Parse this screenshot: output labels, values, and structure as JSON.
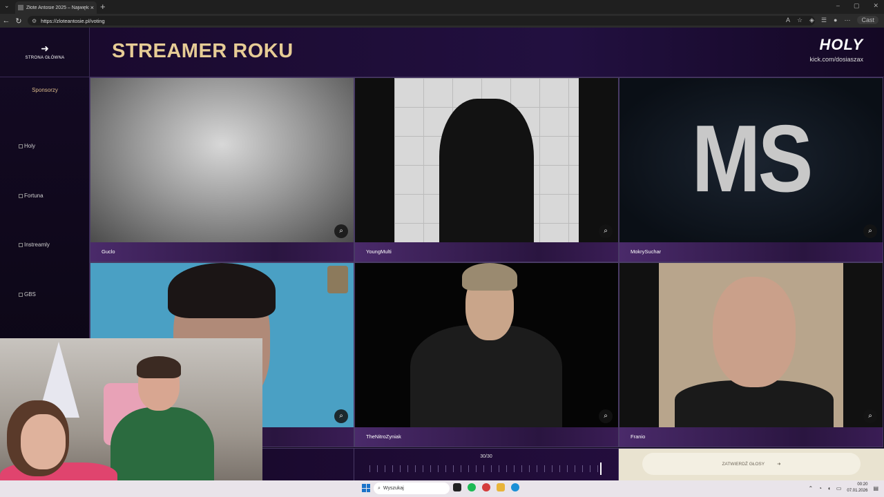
{
  "browser": {
    "tab_title": "Złote Antosie 2025 – Największy",
    "url": "https://zloteantosie.pl/voting",
    "cast_label": "Cast"
  },
  "sidebar": {
    "home_label": "STRONA GŁÓWNA",
    "sponsors_title": "Sponsorzy",
    "sponsors": [
      "Holy",
      "Fortuna",
      "Instreamly",
      "GBS"
    ]
  },
  "header": {
    "title": "STREAMER ROKU",
    "brand": "HOLY",
    "kick": "kick.com/dosiaszax"
  },
  "cards": [
    {
      "name": "Guclo"
    },
    {
      "name": "YoungMulti"
    },
    {
      "name": "MokrySuchar",
      "initials": "MS"
    },
    {
      "name": ""
    },
    {
      "name": "TheNitroZyniak"
    },
    {
      "name": "Franio"
    }
  ],
  "footer": {
    "counter": "30/30",
    "confirm_label": "ZATWIERDŹ GŁOSY"
  },
  "taskbar": {
    "search_placeholder": "Wyszukaj",
    "time": "00:20",
    "date": "07.01.2026"
  }
}
